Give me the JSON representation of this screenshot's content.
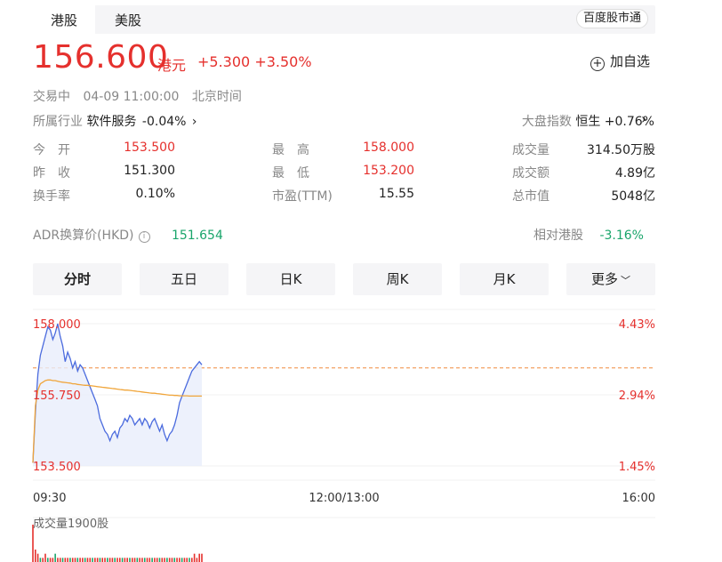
{
  "tabs": [
    {
      "label": "港股",
      "active": true
    },
    {
      "label": "美股",
      "active": false
    }
  ],
  "badge": "百度股市通",
  "quote": {
    "price": "156.600",
    "currency": "港元",
    "change": "+5.300",
    "change_pct": "+3.50%"
  },
  "watch_label": "加自选",
  "status": {
    "state": "交易中",
    "datetime": "04-09 11:00:00",
    "tz": "北京时间"
  },
  "industry": {
    "label": "所属行业",
    "name": "软件服务",
    "change": "-0.04%"
  },
  "market_index": {
    "label": "大盘指数",
    "name": "恒生",
    "change": "+0.76%"
  },
  "stats": [
    [
      {
        "label": "今　开",
        "value": "153.500",
        "color": "red"
      },
      {
        "label": "最　高",
        "value": "158.000",
        "color": "red"
      },
      {
        "label": "成交量",
        "value": "314.50万股",
        "color": ""
      }
    ],
    [
      {
        "label": "昨　收",
        "value": "151.300",
        "color": ""
      },
      {
        "label": "最　低",
        "value": "153.200",
        "color": "red"
      },
      {
        "label": "成交额",
        "value": "4.89亿",
        "color": ""
      }
    ],
    [
      {
        "label": "换手率",
        "value": "0.10%",
        "color": ""
      },
      {
        "label": "市盈(TTM)",
        "value": "15.55",
        "color": ""
      },
      {
        "label": "总市值",
        "value": "5048亿",
        "color": ""
      }
    ]
  ],
  "adr": {
    "label": "ADR换算价(HKD)",
    "value": "151.654",
    "rel_label": "相对港股",
    "rel_value": "-3.16%"
  },
  "periods": [
    "分时",
    "五日",
    "日K",
    "周K",
    "月K",
    "更多"
  ],
  "chart_data": {
    "type": "line",
    "y_left_ticks": [
      "158.000",
      "155.750",
      "153.500"
    ],
    "y_right_ticks": [
      "4.43%",
      "2.94%",
      "1.45%"
    ],
    "x_ticks": [
      "09:30",
      "12:00/13:00",
      "16:00"
    ],
    "ylim": [
      153.5,
      158.0
    ],
    "prev_close": 156.6,
    "series": [
      {
        "values": [
          153.6,
          155.2,
          156.4,
          157.0,
          157.3,
          157.6,
          157.9,
          157.8,
          157.5,
          157.7,
          158.0,
          157.6,
          157.3,
          156.8,
          157.1,
          156.9,
          156.6,
          156.8,
          156.5,
          156.7,
          156.6,
          156.4,
          156.2,
          156.0,
          155.8,
          155.6,
          155.4,
          155.0,
          154.8,
          154.6,
          154.5,
          154.3,
          154.5,
          154.6,
          154.4,
          154.7,
          154.8,
          155.0,
          154.9,
          155.1,
          155.0,
          154.8,
          154.9,
          155.0,
          154.8,
          155.0,
          154.9,
          154.7,
          154.9,
          155.0,
          154.8,
          154.6,
          154.8,
          154.5,
          154.3,
          154.5,
          154.6,
          154.8,
          155.1,
          155.5,
          155.7,
          155.9,
          156.1,
          156.3,
          156.5,
          156.6,
          156.7,
          156.8,
          156.7
        ]
      },
      {
        "values": [
          153.6,
          155.4,
          155.9,
          156.1,
          156.15,
          156.2,
          156.22,
          156.22,
          156.2,
          156.2,
          156.18,
          156.16,
          156.15,
          156.14,
          156.13,
          156.12,
          156.1,
          156.1,
          156.08,
          156.07,
          156.06,
          156.05,
          156.05,
          156.04,
          156.03,
          156.02,
          156.01,
          156.0,
          155.99,
          155.98,
          155.97,
          155.96,
          155.95,
          155.94,
          155.93,
          155.92,
          155.91,
          155.9,
          155.9,
          155.89,
          155.88,
          155.87,
          155.86,
          155.85,
          155.84,
          155.83,
          155.82,
          155.81,
          155.8,
          155.8,
          155.79,
          155.78,
          155.77,
          155.76,
          155.75,
          155.74,
          155.74,
          155.73,
          155.73,
          155.72,
          155.72,
          155.72,
          155.72,
          155.71,
          155.71,
          155.71,
          155.71,
          155.71,
          155.71
        ]
      }
    ],
    "volume_label": "成交量1900股",
    "volume": [
      9,
      3,
      2,
      1,
      1,
      2,
      1,
      1,
      1,
      2,
      1,
      1,
      1,
      1,
      1,
      1,
      1,
      1,
      1,
      1,
      1,
      1,
      1,
      1,
      1,
      1,
      1,
      1,
      1,
      1,
      1,
      1,
      1,
      1,
      1,
      1,
      1,
      1,
      1,
      1,
      1,
      1,
      1,
      1,
      1,
      1,
      1,
      1,
      1,
      1,
      1,
      1,
      1,
      1,
      1,
      1,
      1,
      1,
      1,
      1,
      1,
      1,
      1,
      1,
      1,
      2,
      1,
      2,
      2
    ]
  }
}
